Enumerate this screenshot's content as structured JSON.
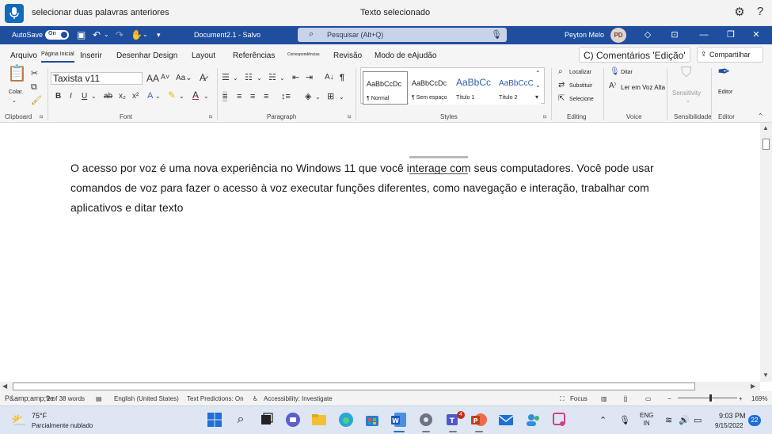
{
  "voice_access": {
    "command_text": "selecionar duas palavras anteriores",
    "status_text": "Texto selecionado"
  },
  "titlebar": {
    "autosave_label": "AutoSave",
    "autosave_state": "On",
    "doc_title": "Document2.1 - Salvo",
    "search_placeholder": "Pesquisar (Alt+Q)",
    "user_name": "Peyton Melo",
    "user_initials": "PD"
  },
  "tabs": {
    "arquivo": "Arquivo",
    "pagina_inicial": "Página Inicial",
    "inserir": "Inserir",
    "desenhar_design": "Desenhar Design",
    "layout": "Layout",
    "referencias": "Referências",
    "correspondencias": "Correspondências",
    "revisao": "Revisão",
    "modo_ajudao": "Modo de eAjudão",
    "comments": "C) Comentários 'Edição'",
    "share": "Compartilhar"
  },
  "ribbon": {
    "clipboard": {
      "label": "Clipboard",
      "paste": "Colar"
    },
    "font": {
      "label": "Font",
      "font_name": "Taxista v11"
    },
    "paragraph": {
      "label": "Paragraph"
    },
    "styles": {
      "label": "Styles",
      "items": [
        {
          "preview": "AaBbCcDc",
          "name": "¶ Normal"
        },
        {
          "preview": "AaBbCcDc",
          "name": "¶ Sem espaço"
        },
        {
          "preview": "AaBbCc",
          "name": "Título 1"
        },
        {
          "preview": "AaBbCcC",
          "name": "Título 2"
        }
      ]
    },
    "editing": {
      "label": "Editing",
      "find": "Localizar",
      "replace": "Substituir",
      "select": "Selecione"
    },
    "voice": {
      "label": "Voice",
      "dictate": "Ditar",
      "read_aloud": "Ler em Voz Alta"
    },
    "sensitivity": {
      "label": "Sensibilidade",
      "button": "Sensitivity"
    },
    "editor": {
      "label": "Editor",
      "button": "Editor"
    }
  },
  "document": {
    "body": "O acesso por voz é uma nova experiência no Windows 11 que você interage com seus computadores. Você pode usar comandos de voz para fazer o acesso à voz executar funções diferentes, como navegação e interação, trabalhar com aplicativos e ditar texto"
  },
  "statusbar": {
    "page": "P&amp;amp;9e",
    "words": "2 of 38 words",
    "language": "English (United States)",
    "text_predictions": "Text Predictions: On",
    "accessibility": "Accessibility: Investigate",
    "focus": "Focus",
    "zoom": "169%"
  },
  "taskbar": {
    "weather_temp": "75°F",
    "weather_desc": "Parcialmente nublado",
    "teams_badge": "4",
    "lang_line1": "ENG",
    "lang_line2": "IN",
    "time": "9:03 PM",
    "date": "9/15/2022",
    "notifications": "22"
  },
  "colors": {
    "titlebar": "#1f4e9e",
    "accent": "#0f6cbd",
    "taskbar": "#dde6f2"
  }
}
